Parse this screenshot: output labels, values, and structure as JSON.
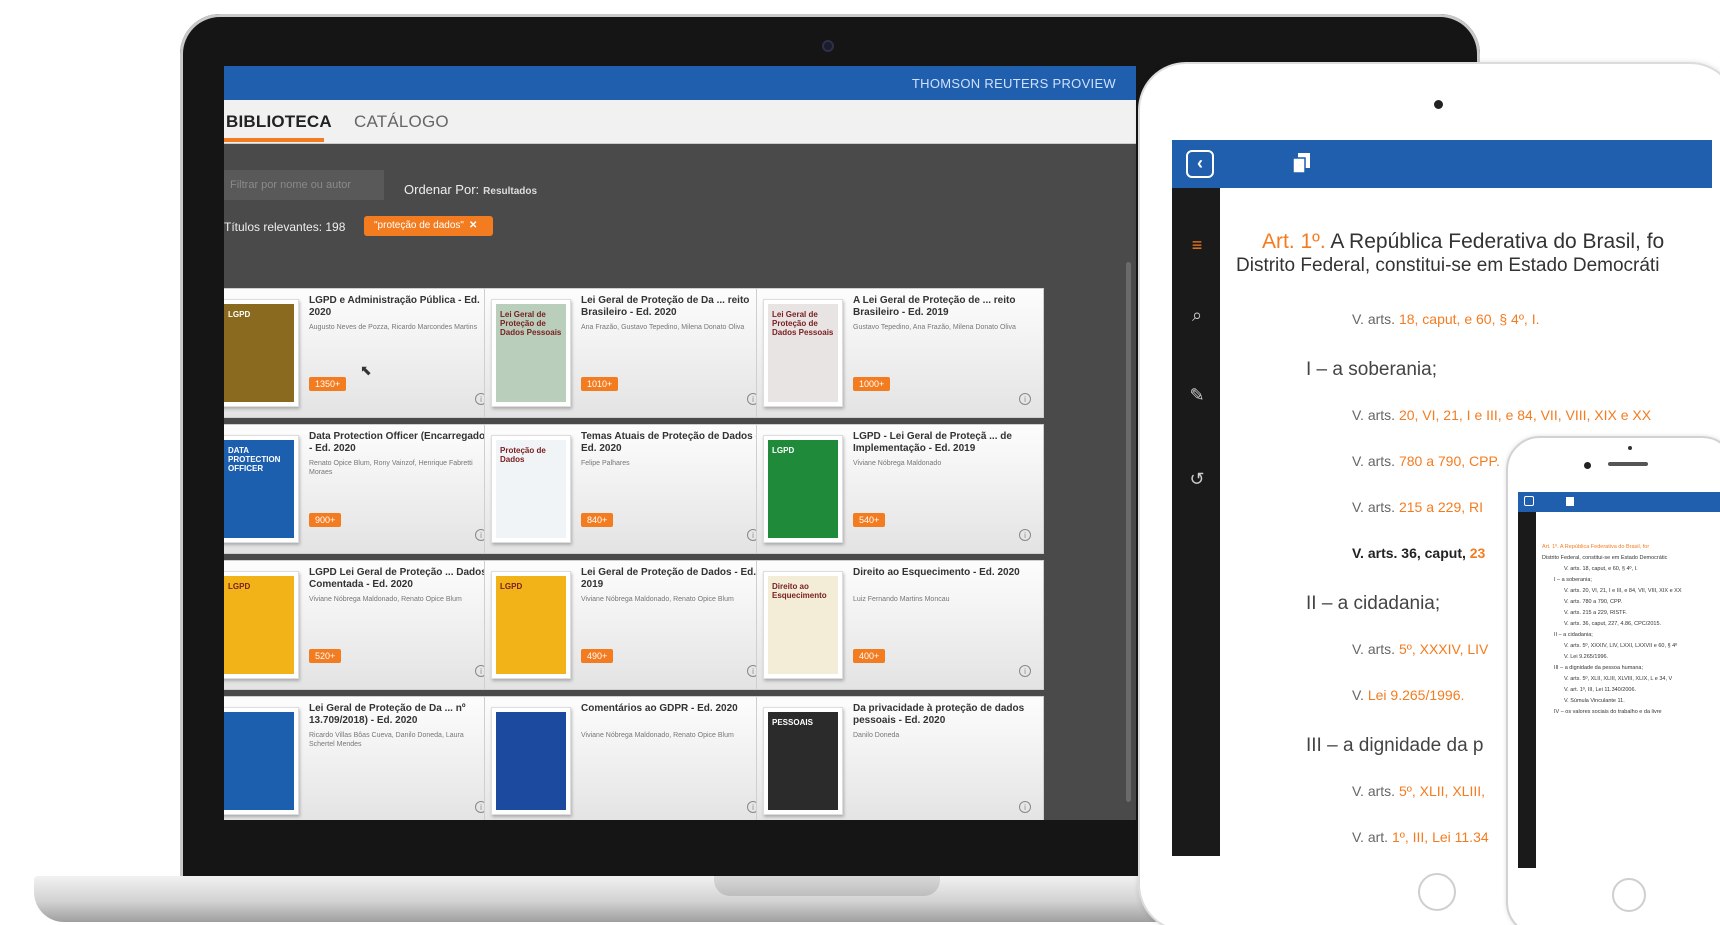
{
  "colors": {
    "brand_blue": "#1f5fad",
    "accent_orange": "#f47c20"
  },
  "laptop": {
    "brand": "THOMSON REUTERS PROVIEW",
    "tabs": [
      {
        "label": "BIBLIOTECA",
        "active": true
      },
      {
        "label": "CATÁLOGO",
        "active": false
      }
    ],
    "filter_placeholder": "Filtrar por nome ou autor",
    "order_label": "Ordenar Por:",
    "order_value": "Resultados",
    "relevant_label": "Títulos relevantes: 198",
    "chip_label": "\"proteção de dados\"",
    "chip_close": "✕",
    "info_icon_glyph": "i",
    "cards": [
      {
        "title": "LGPD e Administração Pública - Ed. 2020",
        "authors": "Augusto Neves de Pozza, Ricardo Marcondes Martins",
        "badge": "1350+",
        "cover_color": "#8a6a1e",
        "cover_text": "LGPD"
      },
      {
        "title": "Lei Geral de Proteção de Da ... reito Brasileiro - Ed. 2020",
        "authors": "Ana Frazão, Gustavo Tepedino, Milena Donato Oliva",
        "badge": "1010+",
        "cover_color": "#b9cfbc",
        "cover_text": "Lei Geral de Proteção de Dados Pessoais"
      },
      {
        "title": "A Lei Geral de Proteção de ... reito Brasileiro - Ed. 2019",
        "authors": "Gustavo Tepedino, Ana Frazão, Milena Donato Oliva",
        "badge": "1000+",
        "cover_color": "#e8e4e4",
        "cover_text": "Lei Geral de Proteção de Dados Pessoais"
      },
      {
        "title": "Data Protection Officer (Encarregado) - Ed. 2020",
        "authors": "Renato Opice Blum, Rony Vainzof, Henrique Fabretti Moraes",
        "badge": "900+",
        "cover_color": "#1c5fae",
        "cover_text": "DATA PROTECTION OFFICER"
      },
      {
        "title": "Temas Atuais de Proteção de Dados - Ed. 2020",
        "authors": "Felipe Palhares",
        "badge": "840+",
        "cover_color": "#f1f4f6",
        "cover_text": "Proteção de Dados"
      },
      {
        "title": "LGPD - Lei Geral de Proteçã ... de Implementação - Ed. 2019",
        "authors": "Viviane Nóbrega Maldonado",
        "badge": "540+",
        "cover_color": "#1f8a3a",
        "cover_text": "LGPD"
      },
      {
        "title": "LGPD Lei Geral de Proteção ... Dados Comentada - Ed. 2020",
        "authors": "Viviane Nóbrega Maldonado, Renato Opice Blum",
        "badge": "520+",
        "cover_color": "#f2b319",
        "cover_text": "LGPD"
      },
      {
        "title": "Lei Geral de Proteção de Dados - Ed. 2019",
        "authors": "Viviane Nóbrega Maldonado, Renato Opice Blum",
        "badge": "490+",
        "cover_color": "#f2b319",
        "cover_text": "LGPD"
      },
      {
        "title": "Direito ao Esquecimento - Ed. 2020",
        "authors": "Luiz Fernando Martins Moncau",
        "badge": "400+",
        "cover_color": "#f3ecd6",
        "cover_text": "Direito ao Esquecimento"
      },
      {
        "title": "Lei Geral de Proteção de Da ... nº 13.709/2018) - Ed. 2020",
        "authors": "Ricardo Villas Bôas Cueva, Danilo Doneda, Laura Schertel Mendes",
        "badge": "",
        "cover_color": "#1c5fae",
        "cover_text": ""
      },
      {
        "title": "Comentários ao GDPR - Ed. 2020",
        "authors": "Viviane Nóbrega Maldonado, Renato Opice Blum",
        "badge": "",
        "cover_color": "#1c4a9e",
        "cover_text": ""
      },
      {
        "title": "Da privacidade à proteção de dados pessoais - Ed. 2020",
        "authors": "Danilo Doneda",
        "badge": "",
        "cover_color": "#2b2b2b",
        "cover_text": "PESSOAIS"
      }
    ]
  },
  "tablet": {
    "back_icon": "‹",
    "side_icons": [
      "list-icon",
      "search-icon",
      "note-icon",
      "history-icon"
    ],
    "side_glyphs": [
      "≡",
      "⌕",
      "✎",
      "↺"
    ],
    "article_num": "Art. 1º.",
    "article_text": "A República Federativa do Brasil, fo",
    "article_text2": "Distrito Federal, constitui-se em Estado Democráti",
    "lines": [
      {
        "kind": "small",
        "pre": "V. arts.",
        "link": "18, caput, e 60, § 4º, I.",
        "post": ""
      },
      {
        "kind": "line",
        "text": "I – a soberania;"
      },
      {
        "kind": "small",
        "pre": "V. arts.",
        "link": "20, VI, 21, I e III, e 84, VII, VIII, XIX e XX",
        "post": ""
      },
      {
        "kind": "small",
        "pre": "V. arts.",
        "link": "780 a 790, CPP.",
        "post": ""
      },
      {
        "kind": "small",
        "pre": "V. arts.",
        "link": "215 a 229, RI",
        "post": ""
      },
      {
        "kind": "bold",
        "pre": "V. arts. 36, caput,",
        "link": "23",
        "post": ""
      },
      {
        "kind": "line",
        "text": "II – a cidadania;"
      },
      {
        "kind": "small",
        "pre": "V. arts.",
        "link": "5º, XXXIV, LIV",
        "post": ""
      },
      {
        "kind": "small",
        "pre": "V.",
        "link": "Lei 9.265/1996.",
        "post": ""
      },
      {
        "kind": "line",
        "text": "III – a dignidade da p"
      },
      {
        "kind": "small",
        "pre": "V. arts.",
        "link": "5º, XLII, XLIII,",
        "post": ""
      },
      {
        "kind": "small",
        "pre": "V. art.",
        "link": "1º, III, Lei 11.34",
        "post": ""
      },
      {
        "kind": "small",
        "pre": "V. Súmula Vinculante",
        "link": "",
        "post": ""
      },
      {
        "kind": "line",
        "text": "IV – os valores soci"
      }
    ]
  },
  "phone": {
    "lines": [
      {
        "t": "Art. 1º. A República Federativa do Brasil, for",
        "o": true
      },
      {
        "t": "Distrito Federal, constitui-se em Estado Democrátic",
        "o": false
      },
      {
        "t": "V. arts. 18, caput, e 60, § 4º, I.",
        "o": false
      },
      {
        "t": "I – a soberania;",
        "o": false
      },
      {
        "t": "V. arts. 20, VI, 21, I e III, e 84, VII, VIII, XIX e XX",
        "o": false
      },
      {
        "t": "V. arts. 780 a 790, CPP.",
        "o": false
      },
      {
        "t": "V. arts. 215 a 229, RISTF.",
        "o": false
      },
      {
        "t": "V. arts. 36, caput, 227, 4.86, CPC/2015.",
        "o": false
      },
      {
        "t": "II – a cidadania;",
        "o": false
      },
      {
        "t": "V. arts. 5º, XXXIV, LIV, LXXI, LXXVII e 60, § 4º",
        "o": false
      },
      {
        "t": "V. Lei 9.265/1996.",
        "o": false
      },
      {
        "t": "III – a dignidade da pessoa humana;",
        "o": false
      },
      {
        "t": "V. arts. 5º, XLII, XLIII, XLVIII, XLIX, L e 34, V",
        "o": false
      },
      {
        "t": "V. art. 1º, III, Lei 11.340/2006.",
        "o": false
      },
      {
        "t": "V. Súmula Vinculante 11.",
        "o": false
      },
      {
        "t": "IV – os valores sociais do trabalho e da livre",
        "o": false
      }
    ]
  }
}
